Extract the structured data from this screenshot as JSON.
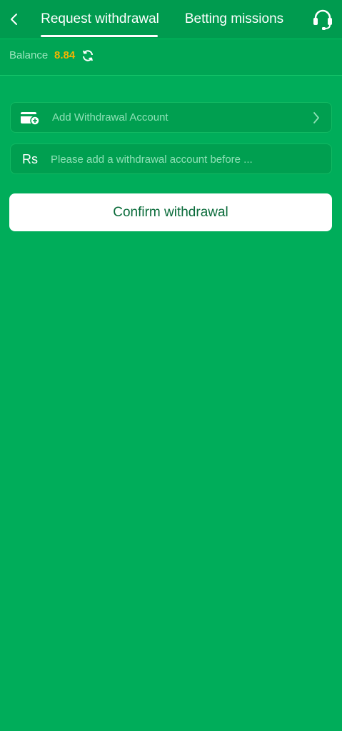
{
  "header": {
    "tabs": [
      {
        "label": "Request withdrawal",
        "active": true
      },
      {
        "label": "Betting missions",
        "active": false
      }
    ],
    "back_icon": "chevron-left-icon",
    "support_icon": "headset-icon"
  },
  "balance": {
    "label": "Balance",
    "value": "8.84",
    "refresh_icon": "refresh-icon"
  },
  "form": {
    "account_label": "Add Withdrawal Account",
    "account_icon": "wallet-add-icon",
    "currency_symbol": "Rs",
    "amount_placeholder": "Please add a withdrawal account before ...",
    "amount_value": ""
  },
  "confirm_label": "Confirm withdrawal",
  "colors": {
    "background": "#00ad5a",
    "header": "#009b4f",
    "balance_value": "#f5b400",
    "button_text": "#0a6b3a"
  }
}
